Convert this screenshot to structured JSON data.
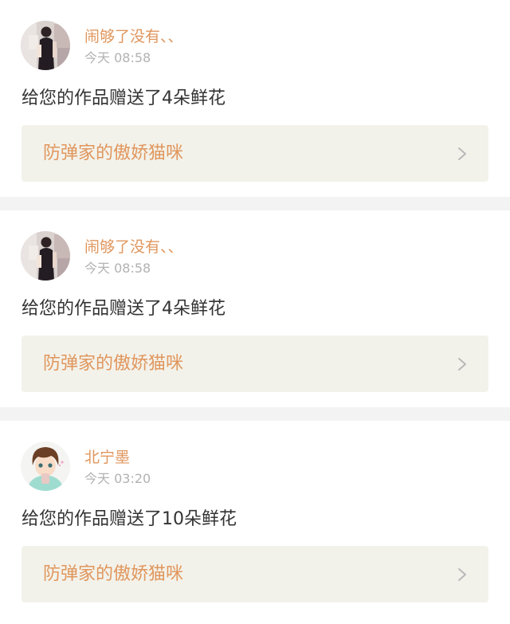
{
  "notifications": [
    {
      "avatar_icon": "user-photo-avatar",
      "username": "闹够了没有、、",
      "time": "今天 08:58",
      "message": "给您的作品赠送了4朵鲜花",
      "work_title": "防弹家的傲娇猫咪",
      "chevron_icon": "chevron-right-icon"
    },
    {
      "avatar_icon": "user-photo-avatar",
      "username": "闹够了没有、、",
      "time": "今天 08:58",
      "message": "给您的作品赠送了4朵鲜花",
      "work_title": "防弹家的傲娇猫咪",
      "chevron_icon": "chevron-right-icon"
    },
    {
      "avatar_icon": "anime-boy-avatar",
      "username": "北宁墨",
      "time": "今天 03:20",
      "message": "给您的作品赠送了10朵鲜花",
      "work_title": "防弹家的傲娇猫咪",
      "chevron_icon": "chevron-right-icon"
    }
  ],
  "colors": {
    "accent": "#e0965d",
    "timestamp": "#b2b2b2",
    "text": "#333333",
    "link_background": "#f3f2ea",
    "page_background": "#f3f3f3"
  }
}
